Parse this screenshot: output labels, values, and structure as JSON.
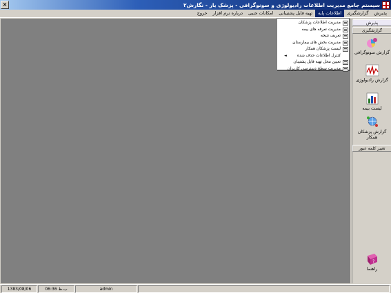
{
  "window": {
    "title": "سیستم جامع مدیریت اطلاعات رادیولوژی و سونوگرافی - پزشک یار - نگارش۲",
    "close_glyph": "×"
  },
  "menubar": {
    "items": [
      "پذیرش",
      "گزارشگیری",
      "اطلاعات پایه",
      "تهیه فایل پشتیبانی",
      "امکانات جنبی",
      "درباره نرم افزار",
      "خروج"
    ]
  },
  "dropdown": {
    "items": [
      "مدیریت اطلاعات پزشکان",
      "مدیریت تعرفه های بیمه",
      "تعریف نتیجه",
      "مدیریت بخش های بیمارستان",
      "لیست پزشکان همکار",
      "کنترل اطلاعات حذف شده",
      "تعیین محل تهیه فایل پشتیبان",
      "مدیریت سطح دسترسی کاربران"
    ],
    "submenu_arrow": "◄"
  },
  "sidebar": {
    "section_admission": "پذیرش",
    "section_reports": "گزارشگیری",
    "buttons": [
      "گزارش سونوگرافی",
      "گزارش رادیولوژی",
      "لیست بیمه",
      "گزارش پزشکان همکار"
    ],
    "change_password": "تغییر کلمه عبور",
    "help": "راهنما"
  },
  "statusbar": {
    "date": "1383/08/06",
    "time": "06:36 ب.ظ",
    "user": "admin"
  },
  "colors": {
    "titlebar_dark": "#0a246a",
    "workspace": "#808080",
    "chrome": "#d4d0c8"
  }
}
